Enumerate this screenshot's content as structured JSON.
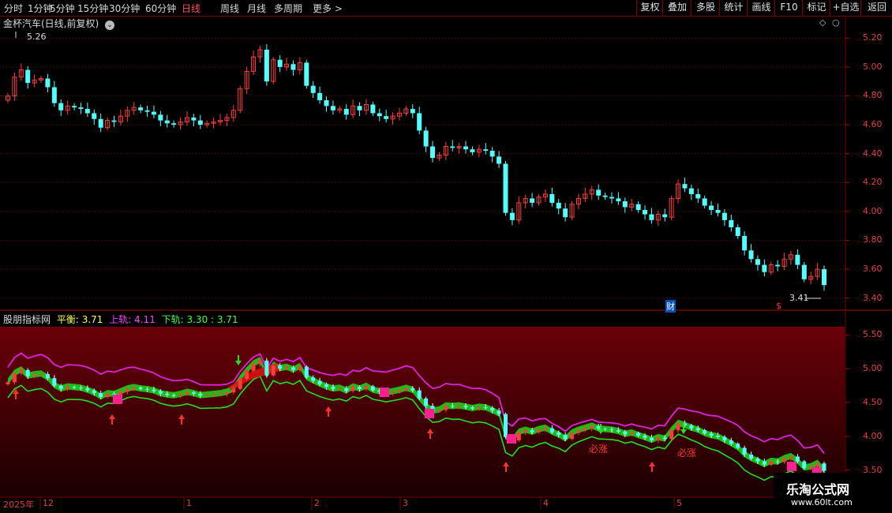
{
  "toolbar": {
    "left_items": [
      "分时",
      "1分钟",
      "5分钟",
      "15分钟",
      "30分钟",
      "60分钟",
      "日线",
      "周线",
      "月线",
      "多周期",
      "更多 >"
    ],
    "active_item": "日线",
    "right_items": [
      "复权",
      "叠加",
      "多股",
      "统计",
      "画线",
      "F10",
      "标记",
      "+自选",
      "返回"
    ]
  },
  "main_chart": {
    "title": "金杯汽车(日线,前复权)",
    "high_label": "5.26",
    "low_label": "3.41",
    "marker_cai": "财",
    "marker_dollar": "$",
    "y_ticks": [
      "5.20",
      "5.00",
      "4.80",
      "4.60",
      "4.40",
      "4.20",
      "4.00",
      "3.80",
      "3.60",
      "3.40"
    ]
  },
  "indicator": {
    "name": "股朋指标网",
    "ping_label": "平衡: 3.71",
    "upper_label": "上轨: 4.11",
    "lower_label": "下轨: 3.30 : 3.71",
    "y_ticks": [
      "5.50",
      "5.00",
      "4.50",
      "4.00",
      "3.50"
    ],
    "bizhang_text": "必涨"
  },
  "x_axis": {
    "labels": [
      "2025年",
      "12",
      "1",
      "2",
      "3",
      "4",
      "5"
    ]
  },
  "watermark": {
    "line1": "乐淘公式网",
    "line2": "www.60lt.com"
  },
  "colors": {
    "up": "#ff3c3c",
    "down": "#54ffff",
    "grid": "#7a0000",
    "upper_band": "#e020e0",
    "lower_band": "#20e020"
  },
  "chart_data": {
    "type": "candlestick",
    "title": "金杯汽车(日线,前复权)",
    "y_range": [
      3.36,
      5.3
    ],
    "closes": [
      4.8,
      4.93,
      4.98,
      4.89,
      4.91,
      4.92,
      4.86,
      4.75,
      4.7,
      4.73,
      4.72,
      4.71,
      4.68,
      4.64,
      4.58,
      4.63,
      4.62,
      4.66,
      4.7,
      4.72,
      4.7,
      4.69,
      4.67,
      4.63,
      4.61,
      4.6,
      4.62,
      4.65,
      4.63,
      4.6,
      4.61,
      4.62,
      4.63,
      4.65,
      4.7,
      4.85,
      4.97,
      5.07,
      5.12,
      4.9,
      5.05,
      5.0,
      5.02,
      4.98,
      5.03,
      4.87,
      4.82,
      4.77,
      4.73,
      4.7,
      4.71,
      4.67,
      4.73,
      4.7,
      4.74,
      4.68,
      4.66,
      4.64,
      4.66,
      4.68,
      4.71,
      4.68,
      4.56,
      4.45,
      4.37,
      4.39,
      4.45,
      4.44,
      4.45,
      4.43,
      4.41,
      4.43,
      4.42,
      4.38,
      4.33,
      3.99,
      3.94,
      4.06,
      4.09,
      4.06,
      4.1,
      4.12,
      4.06,
      4.02,
      3.96,
      4.05,
      4.09,
      4.12,
      4.15,
      4.11,
      4.1,
      4.09,
      4.07,
      4.03,
      4.05,
      4.01,
      3.98,
      3.94,
      3.98,
      3.96,
      4.09,
      4.19,
      4.16,
      4.12,
      4.09,
      4.04,
      4.01,
      3.99,
      3.94,
      3.89,
      3.83,
      3.73,
      3.67,
      3.63,
      3.58,
      3.63,
      3.62,
      3.67,
      3.7,
      3.63,
      3.53,
      3.55,
      3.6,
      3.49
    ]
  }
}
